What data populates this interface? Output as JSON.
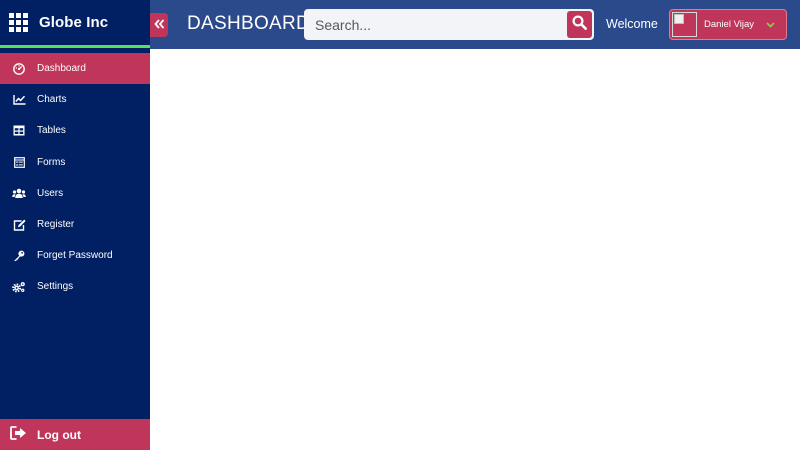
{
  "app": {
    "brand": "Globe Inc"
  },
  "header": {
    "title": "DASHBOARD",
    "search_placeholder": "Search...",
    "welcome": "Welcome",
    "user_name": "Daniel Vijay"
  },
  "sidebar": {
    "items": [
      {
        "label": "Dashboard",
        "icon": "dashboard-icon",
        "active": true
      },
      {
        "label": "Charts",
        "icon": "chart-line-icon",
        "active": false
      },
      {
        "label": "Tables",
        "icon": "table-icon",
        "active": false
      },
      {
        "label": "Forms",
        "icon": "form-icon",
        "active": false
      },
      {
        "label": "Users",
        "icon": "users-icon",
        "active": false
      },
      {
        "label": "Register",
        "icon": "edit-icon",
        "active": false
      },
      {
        "label": "Forget Password",
        "icon": "key-icon",
        "active": false
      },
      {
        "label": "Settings",
        "icon": "cogs-icon",
        "active": false
      }
    ],
    "logout": "Log out"
  },
  "colors": {
    "sidebar_bg": "#002063",
    "header_bg": "#2b4a8c",
    "accent": "#c0355a",
    "brand_underline": "#59e05a",
    "caret": "#7cd34a"
  }
}
